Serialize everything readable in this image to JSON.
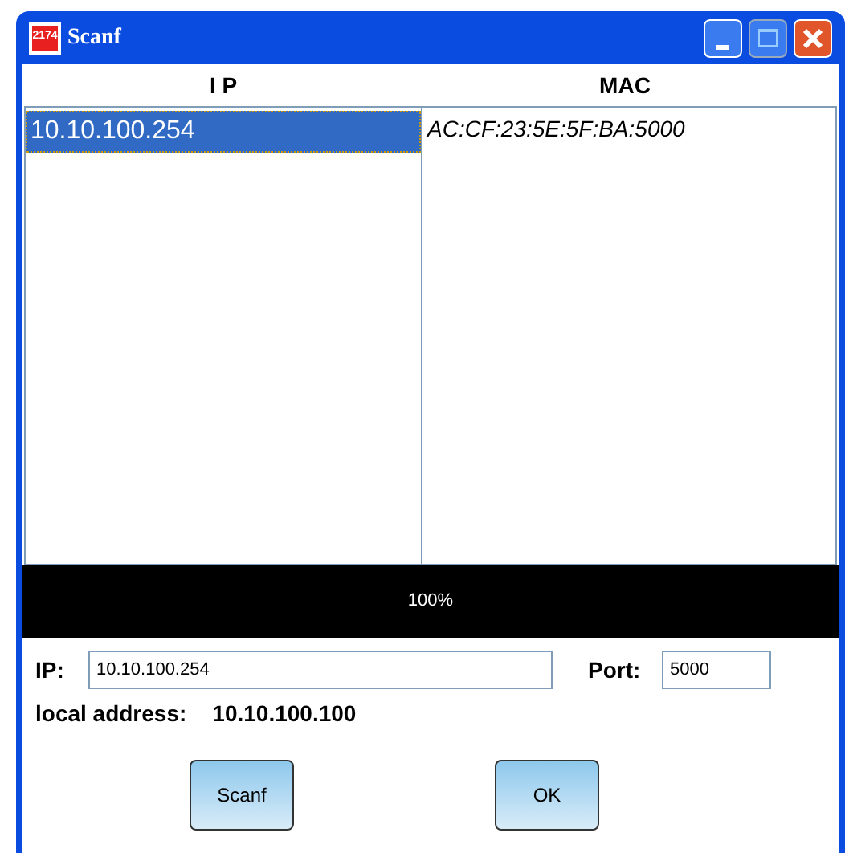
{
  "window": {
    "title": "Scanf",
    "icon_text": "2174"
  },
  "table": {
    "columns": [
      "I P",
      "MAC"
    ],
    "rows": [
      {
        "ip": "10.10.100.254",
        "mac": "AC:CF:23:5E:5F:BA:5000",
        "selected": true
      }
    ]
  },
  "progress": {
    "level": 1,
    "reading": "100%"
  },
  "ip_field": {
    "label": "IP:",
    "value": "10.10.100.254"
  },
  "port_field": {
    "label": "Port:",
    "value": "5000"
  },
  "local_address": {
    "label": "local address:",
    "value": "10.10.100.100"
  },
  "buttons": [
    "Scanf",
    "OK"
  ]
}
